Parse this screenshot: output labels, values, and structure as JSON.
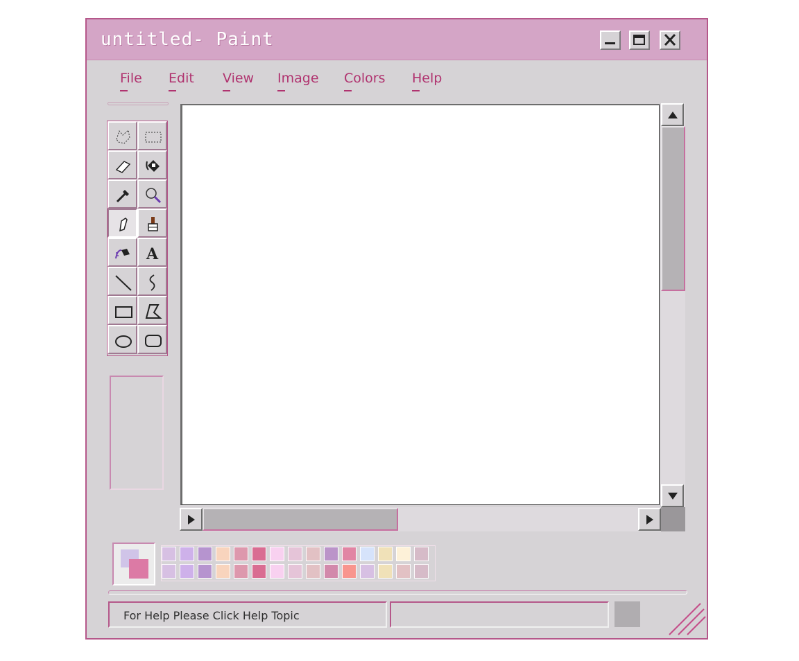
{
  "window": {
    "title": "untitled- Paint",
    "controls": [
      "minimize-icon",
      "maximize-icon",
      "close-icon"
    ]
  },
  "menu": [
    {
      "label": "File"
    },
    {
      "label": "Edit"
    },
    {
      "label": "View"
    },
    {
      "label": "Image"
    },
    {
      "label": "Colors"
    },
    {
      "label": "Help"
    }
  ],
  "tools": [
    "free-form-select-icon",
    "rect-select-icon",
    "eraser-icon",
    "fill-bucket-icon",
    "color-picker-icon",
    "magnifier-icon",
    "pencil-icon",
    "brush-icon",
    "airbrush-icon",
    "text-icon",
    "line-icon",
    "curve-icon",
    "rectangle-icon",
    "polygon-icon",
    "ellipse-icon",
    "rounded-rect-icon"
  ],
  "selected_tool": "pencil-icon",
  "colors": {
    "accent": "#b5578a",
    "titlebar": "#d4a5c6",
    "foreground": "#d0c4e8",
    "background": "#dc7aa5",
    "palette_row1": [
      "#d7c0e3",
      "#ceb1ea",
      "#b694cf",
      "#f8d4bd",
      "#dd98ad",
      "#d96d92",
      "#f8d1f0",
      "#e5c4d8",
      "#e2c1c4",
      "#bb94c9",
      "#e185a4",
      "#d6e3fb",
      "#f0e1b8",
      "#fdf1d8",
      "#d6bbc8"
    ],
    "palette_row2": [
      "#d7c0e3",
      "#ceb1ea",
      "#b694cf",
      "#f8d4bd",
      "#dd98ad",
      "#d96d92",
      "#f8d1f0",
      "#e5c4d8",
      "#e2c1c4",
      "#d289ab",
      "#f8958e",
      "#d7c0e3",
      "#f0e1b8",
      "#e2c1c4",
      "#d6bbc8"
    ]
  },
  "status": {
    "help_text": "For Help Please Click Help Topic",
    "coords": "",
    "size": ""
  }
}
